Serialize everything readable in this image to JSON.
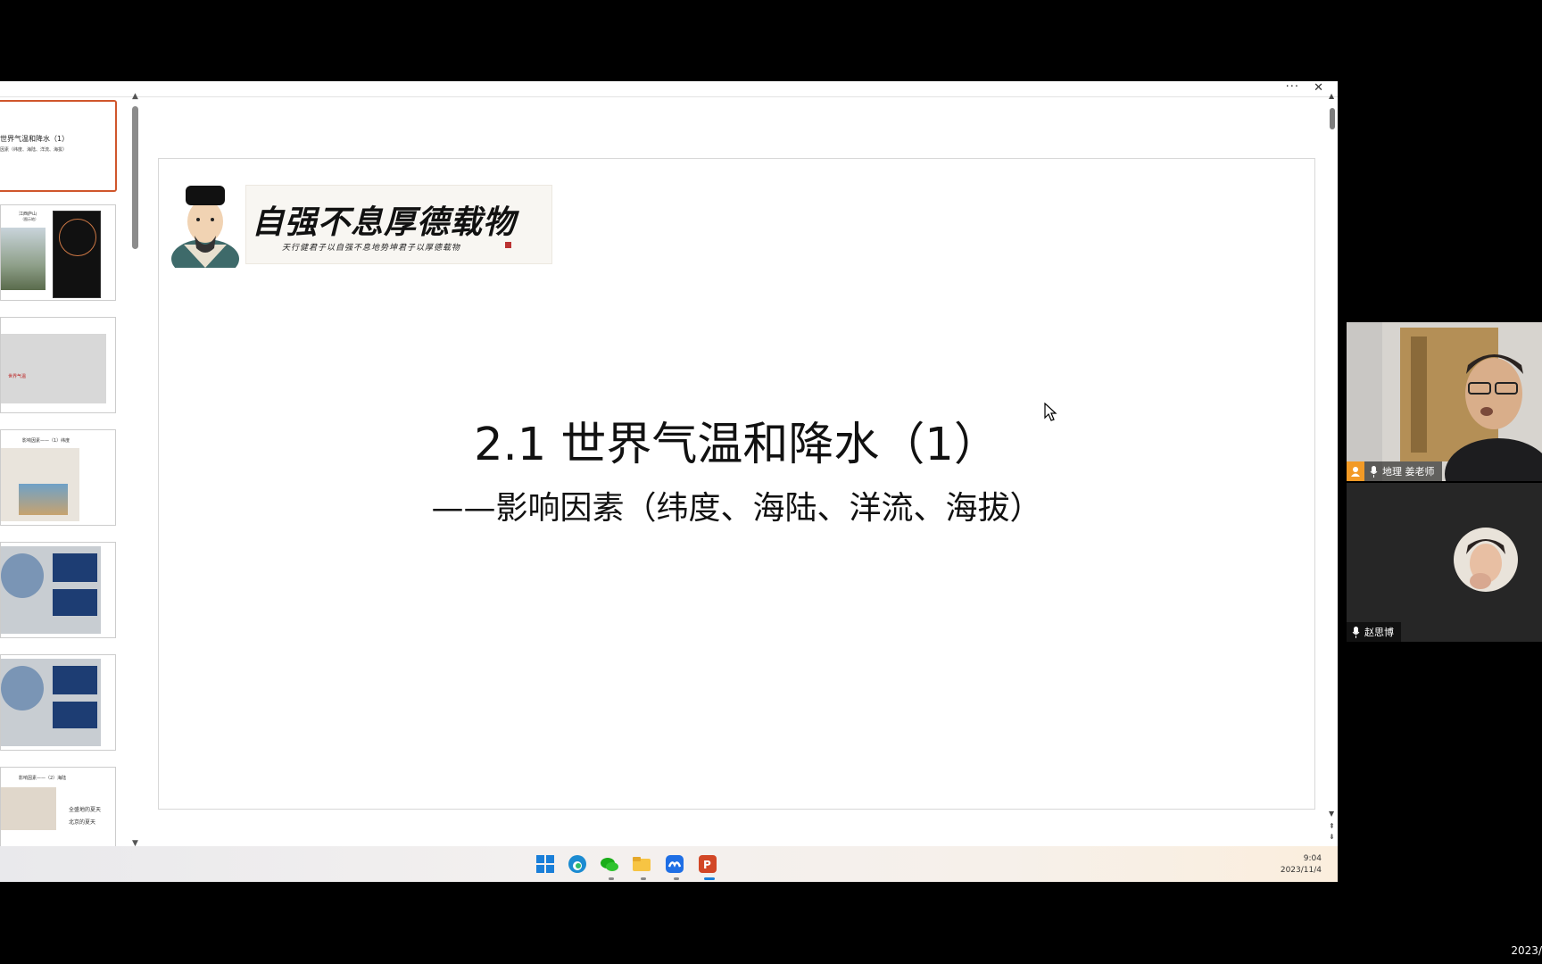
{
  "window": {
    "more_label": "···",
    "close_label": "✕"
  },
  "thumbnails": [
    {
      "title": "世界气温和降水（1）",
      "subtitle": "因素（纬度、海陆、洋流、海拔）"
    },
    {
      "title": "江西庐山",
      "subtitle": "（图示地）"
    },
    {
      "title": "世界气温"
    },
    {
      "title": "影响因素——（1）纬度"
    },
    {
      "title": ""
    },
    {
      "title": ""
    },
    {
      "title": "影响因素——（2）海陆",
      "notes": [
        "全盛地的夏天",
        "北京的夏天"
      ]
    }
  ],
  "slide": {
    "banner_text": "自强不息厚德载物",
    "banner_small": "天行健君子以自强不息地势坤君子以厚德载物",
    "title": "2.1 世界气温和降水（1）",
    "subtitle": "——影响因素（纬度、海陆、洋流、海拔）"
  },
  "taskbar": {
    "apps": [
      "windows-start",
      "edge",
      "wechat",
      "file-explorer",
      "tencent-meeting",
      "powerpoint"
    ],
    "time": "9:04",
    "date": "2023/11/4"
  },
  "participants": [
    {
      "name": "地理 姜老师",
      "role": "host"
    },
    {
      "name": "赵思博"
    }
  ],
  "outer_date": "2023/",
  "colors": {
    "accent": "#d0562c",
    "host_badge": "#f29a26"
  }
}
